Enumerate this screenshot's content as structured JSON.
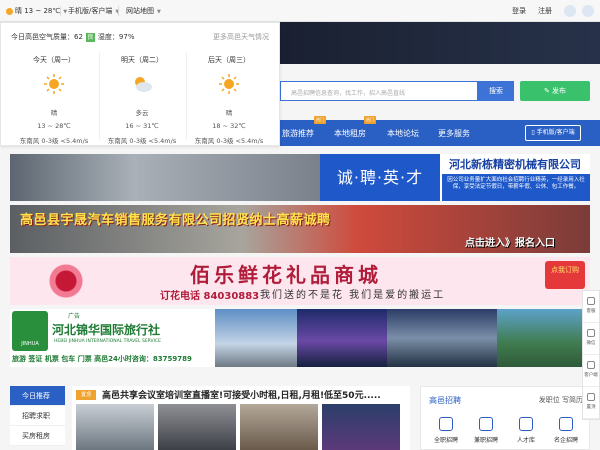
{
  "topbar": {
    "weather_text": "晴 13 ~ 28℃",
    "mobile": "手机版/客户端",
    "sitemap": "网站地图",
    "login": "登录",
    "register": "注册"
  },
  "weather_panel": {
    "aq_label": "今日高邑空气质量：62",
    "aq_level": "良",
    "humidity": "湿度：97%",
    "more": "更多高邑天气情况",
    "days": [
      {
        "name": "今天（周一）",
        "cond": "晴",
        "temp": "13 ~ 28℃",
        "wind": "东南风 0-3级 <5.4m/s",
        "icon": "sun-icon"
      },
      {
        "name": "明天（周二）",
        "cond": "多云",
        "temp": "16 ~ 31℃",
        "wind": "东南风 0-3级 <5.4m/s",
        "icon": "partly-cloudy-icon"
      },
      {
        "name": "后天（周三）",
        "cond": "晴",
        "temp": "18 ~ 32℃",
        "wind": "东南风 0-3级 <5.4m/s",
        "icon": "sun-icon"
      }
    ]
  },
  "search": {
    "placeholder": "高邑招聘信息查询，找工作，招人高邑直线",
    "button": "搜索",
    "publish": "发布"
  },
  "nav": {
    "items": [
      "旅游推荐",
      "本地租房",
      "本地论坛",
      "更多服务"
    ],
    "badge": "热门",
    "mobile": "手机版/客户端"
  },
  "banners": {
    "b1_blue": "诚·聘·英·才",
    "b1_company": "河北新栋精密机械有限公司",
    "b1_desc": "因公司业务量扩大面向社会招聘行业精英，一经录用入社保，享受法定节假日，带薪年假、公休、包工作餐。",
    "b2_title": "高邑县宇晟汽车销售服务有限公司招贤纳士高薪诚聘",
    "b2_cta": "点击进入》报名入口",
    "b3_title": "佰乐鲜花礼品商城",
    "b3_phone": "订花电话 84030883",
    "b3_sub": "我们送的不是花  我们是爱的搬运工",
    "b3_box": "点我订购",
    "b4_title": "河北锦华国际旅行社",
    "b4_en": "HEBEI JINHUA INTERNATIONAL TRAVEL SERVICE",
    "b4_ad": "广告",
    "b4_bottom": "旅游 签证 机票 包车 门票 高邑24小时咨询：83759789"
  },
  "left_menu": [
    "今日推荐",
    "招聘求职",
    "买房租房"
  ],
  "news": {
    "tag": "置顶",
    "title": "高邑共享会议室培训室直播室!可接受小时租,日租,月租!低至50元....."
  },
  "recruit": {
    "title": "高邑招聘",
    "link1": "发职位",
    "link2": "写简历",
    "icons": [
      "全职招聘",
      "兼职招聘",
      "人才库",
      "名企招聘"
    ]
  },
  "side_float": [
    "客服",
    "微信",
    "客户端",
    "置顶"
  ],
  "colors": {
    "primary": "#2a5fc4",
    "green": "#39c16c",
    "orange": "#f0a22e"
  }
}
